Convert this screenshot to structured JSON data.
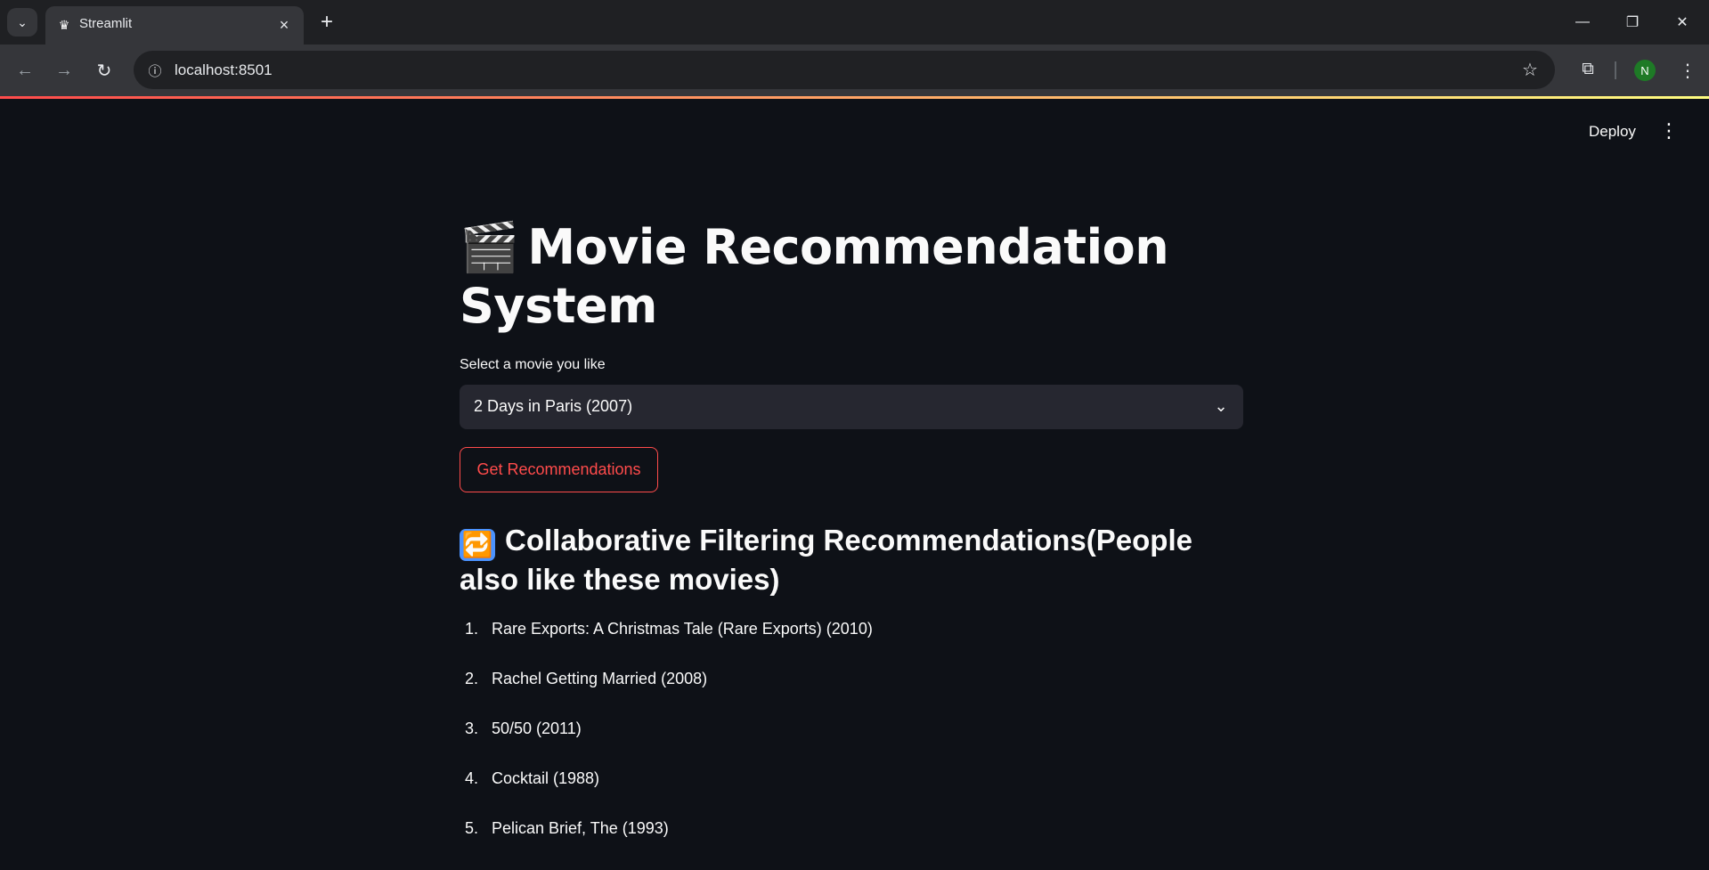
{
  "browser": {
    "tab_title": "Streamlit",
    "url": "localhost:8501",
    "avatar_initial": "N"
  },
  "app": {
    "deploy_label": "Deploy",
    "title_emoji": "🎬",
    "title": "Movie Recommendation System",
    "select_label": "Select a movie you like",
    "selected_movie": "2 Days in Paris (2007)",
    "button_label": "Get Recommendations",
    "section_emoji": "🔁",
    "section_title": "Collaborative Filtering Recommendations(People also like these movies)",
    "recommendations": [
      "Rare Exports: A Christmas Tale (Rare Exports) (2010)",
      "Rachel Getting Married (2008)",
      "50/50 (2011)",
      "Cocktail (1988)",
      "Pelican Brief, The (1993)"
    ],
    "recommendation_numbers": [
      "1.",
      "2.",
      "3.",
      "4.",
      "5."
    ]
  },
  "colors": {
    "app_background": "#0e1117",
    "accent": "#ff4b4b",
    "select_background": "#262730"
  },
  "icons": {
    "tab_list": "chevron-down-icon",
    "favicon": "streamlit-crown-icon",
    "back": "arrow-left-icon",
    "forward": "arrow-right-icon",
    "reload": "reload-icon",
    "site_info": "info-icon",
    "bookmark": "star-icon",
    "extensions": "puzzle-icon"
  }
}
